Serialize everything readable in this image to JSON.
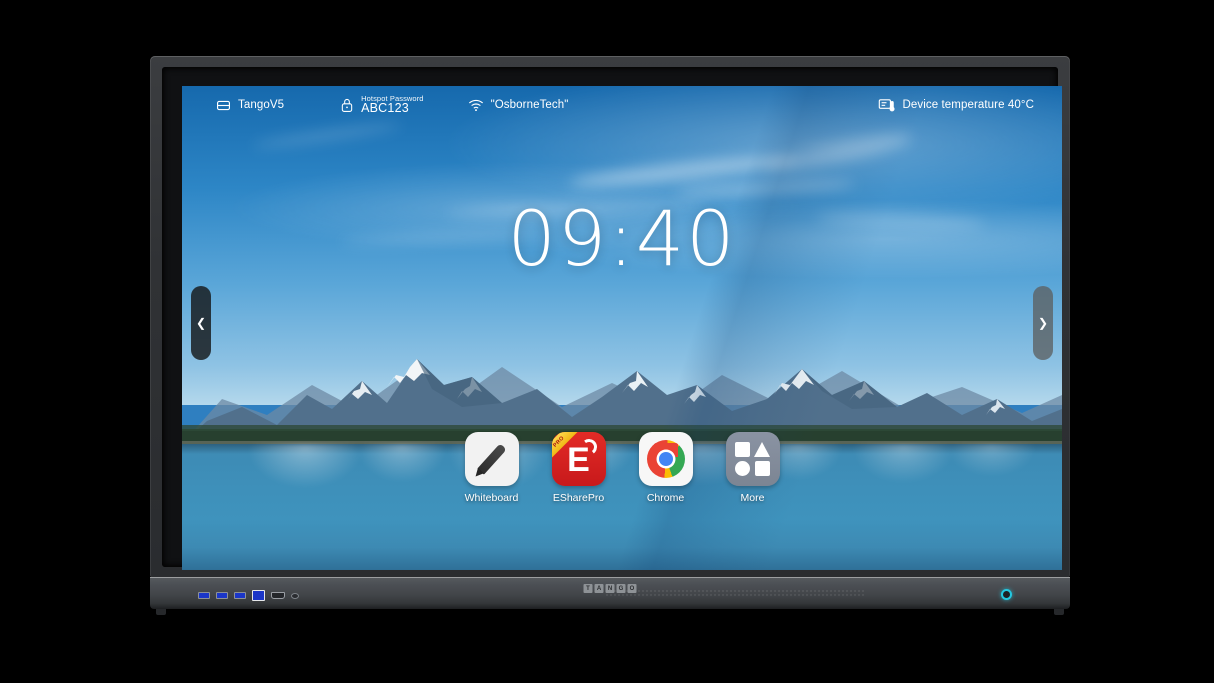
{
  "device": {
    "brand": "TANGO",
    "brand_letters": [
      "T",
      "A",
      "N",
      "G",
      "O"
    ]
  },
  "statusbar": {
    "device_name": "TangoV5",
    "device_icon": "display-icon",
    "hotspot": {
      "icon": "lock-icon",
      "label": "Hotspot Password",
      "value": "ABC123"
    },
    "wifi": {
      "icon": "wifi-icon",
      "ssid": "\"OsborneTech\""
    },
    "temperature": {
      "icon": "device-temperature-icon",
      "text": "Device temperature 40°C"
    }
  },
  "clock": {
    "time": "09:40"
  },
  "handles": {
    "left": "❮",
    "right": "❯"
  },
  "dock": {
    "apps": [
      {
        "label": "Whiteboard",
        "icon": "whiteboard-pen-icon"
      },
      {
        "label": "ESharePro",
        "icon": "eshare-icon",
        "badge": "PRO"
      },
      {
        "label": "Chrome",
        "icon": "chrome-icon"
      },
      {
        "label": "More",
        "icon": "more-apps-icon"
      }
    ]
  },
  "colors": {
    "accent_red": "#d8201f",
    "accent_cyan": "#23c8e0",
    "chrome_blue": "#4285f4",
    "chrome_red": "#ea4335",
    "chrome_green": "#34a853",
    "chrome_yellow": "#fbbc05",
    "badge_gold": "#ffd84d",
    "sky_blue": "#2d86c6",
    "lake_blue": "#3f90ba"
  },
  "ports": [
    {
      "name": "usb-port",
      "type": "usb"
    },
    {
      "name": "usb-port",
      "type": "usb"
    },
    {
      "name": "usb-port",
      "type": "usb"
    },
    {
      "name": "usb-port-highlighted",
      "type": "usb-hl"
    },
    {
      "name": "hdmi-port",
      "type": "hdmi"
    },
    {
      "name": "headphone-jack",
      "type": "jack"
    }
  ]
}
